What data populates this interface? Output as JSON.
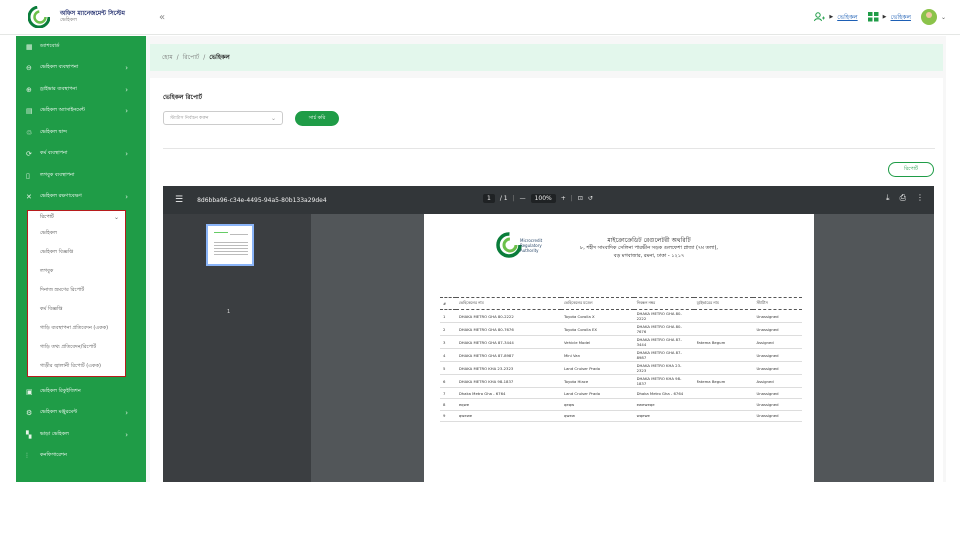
{
  "app": {
    "title": "অফিস ম্যানেজমেন্ট সিস্টেম",
    "subtitle": "ভেহিকল",
    "collapse_icon": "«"
  },
  "topbar": {
    "items": [
      "ভেহিকল",
      "ভেহিকল"
    ]
  },
  "sidebar": {
    "items": [
      {
        "label": "ড্যাশবোর্ড",
        "icon": "▦",
        "chevron": false
      },
      {
        "label": "ভেহিকল ব্যবস্থাপনা",
        "icon": "⊖",
        "chevron": true
      },
      {
        "label": "ড্রাইভার ব্যবস্থাপনা",
        "icon": "⊕",
        "chevron": true
      },
      {
        "label": "ভেহিকল অ্যাসাইনমেন্ট",
        "icon": "▤",
        "chevron": true
      },
      {
        "label": "ভেহিকল দ্বান্দ",
        "icon": "♲",
        "chevron": false
      },
      {
        "label": "কর্ম ব্যবস্থাপনা",
        "icon": "⟳",
        "chevron": true
      },
      {
        "label": "লগবুক ব্যবস্থাপনা",
        "icon": "▯",
        "chevron": false
      },
      {
        "label": "ভেহিকল রক্ষণাবেক্ষণ",
        "icon": "✕",
        "chevron": true
      }
    ],
    "submenu": {
      "title": "রিপোর্ট",
      "items": [
        "ভেহিকল",
        "ভেহিকল বিজ্ঞপ্তি",
        "লগবুক",
        "দিনাজ ভ্রমণের রিপোর্ট",
        "কর্ম বিজ্ঞপ্তি",
        "গাড়ি ব্যবস্থাপনা প্রতিবেদন (একক)",
        "গাড়ি তথ্য প্রতিবেদন/রিপোর্ট",
        "গাড়ীর জ্বালানী রিপোর্ট (একক)"
      ]
    },
    "bottom_items": [
      {
        "label": "ভেহিকল রিকুইজিশন",
        "icon": "▣",
        "chevron": false
      },
      {
        "label": "ভেহিকল মঞ্জুরমেন্ট",
        "icon": "⚙",
        "chevron": true
      },
      {
        "label": "ভাড়া ভেহিকল",
        "icon": "▚",
        "chevron": true
      },
      {
        "label": "কনফিগারেশন",
        "icon": "⫶",
        "chevron": false
      }
    ]
  },
  "breadcrumb": {
    "items": [
      "হোম",
      "রিপোর্ট",
      "ভেহিকল"
    ],
    "separator": "/"
  },
  "report": {
    "title": "ভেহিকল রিপোর্ট",
    "select_placeholder": "স্ট্যাটাস নির্বাচন করুন",
    "search_button": "সার্চ করি",
    "report_button": "রিপোর্ট"
  },
  "viewer": {
    "filename": "8d6bba96-c34e-4495-94a5-80b133a29de4",
    "page_current": "1",
    "page_sep": "/ 1",
    "zoom": "100%",
    "thumb_page": "1"
  },
  "pdf": {
    "logo_text": [
      "Microcredit",
      "Regulatory",
      "Authority"
    ],
    "heading": "মাইক্রোক্রেডিট রেগুলেটরী অথরিটি",
    "address1": "৮, শহীদ সাংবাদিক সেলিনা পারভীন সড়ক গুলফেশা প্লাজা (৭ম তলা),",
    "address2": "বড় মগবাজার, রমনা, ঢাকা - ১২১৭",
    "columns": [
      "#",
      "ভেহিকেলের নাম",
      "ভেহিকেলের মডেল",
      "নিবন্ধন নম্বর",
      "ড্রাইভারের নাম",
      "স্ট্যাটাস"
    ],
    "rows": [
      [
        "1",
        "DHAKA METRO GHA 80-2222",
        "Toyota Corolla X",
        "DHAKA METRO GHA 80-2222",
        "",
        "Unassigned"
      ],
      [
        "2",
        "DHAKA METRO GHA 80-7676",
        "Toyota Corolla EX",
        "DHAKA METRO GHA 80-7676",
        "",
        "Unassigned"
      ],
      [
        "3",
        "DHAKA METRO GHA 87-3444",
        "Vehicle Model",
        "DHAKA METRO GHA 87-3444",
        "Fatema Begum",
        "Assigned"
      ],
      [
        "4",
        "DHAKA METRO GHA 87-8987",
        "Mini Van",
        "DHAKA METRO GHA 87-8987",
        "",
        "Unassigned"
      ],
      [
        "5",
        "DHAKA METRO KHA 23-2323",
        "Land Cruiser Prado",
        "DHAKA METRO KHA 23-2323",
        "",
        "Unassigned"
      ],
      [
        "6",
        "DHAKA METRO KHA 98-1837",
        "Toyota Hiace",
        "DHAKA METRO KHA 98-1837",
        "Fatema Begum",
        "Assigned"
      ],
      [
        "7",
        "Dhaka Metro Gha - 6764",
        "Land Cruiser Prado",
        "Dhaka Metro Gha - 6764",
        "",
        "Unassigned"
      ],
      [
        "8",
        "eqwe",
        "qeqw",
        "eweweqe",
        "",
        "Unassigned"
      ],
      [
        "9",
        "qwewe",
        "qwew",
        "wqewe",
        "",
        "Unassigned"
      ]
    ]
  },
  "colors": {
    "brand": "#1f9c47",
    "breadcrumb_bg": "#e3f7ec",
    "viewer_bg": "#525659",
    "highlight_border": "#b71c1c"
  }
}
